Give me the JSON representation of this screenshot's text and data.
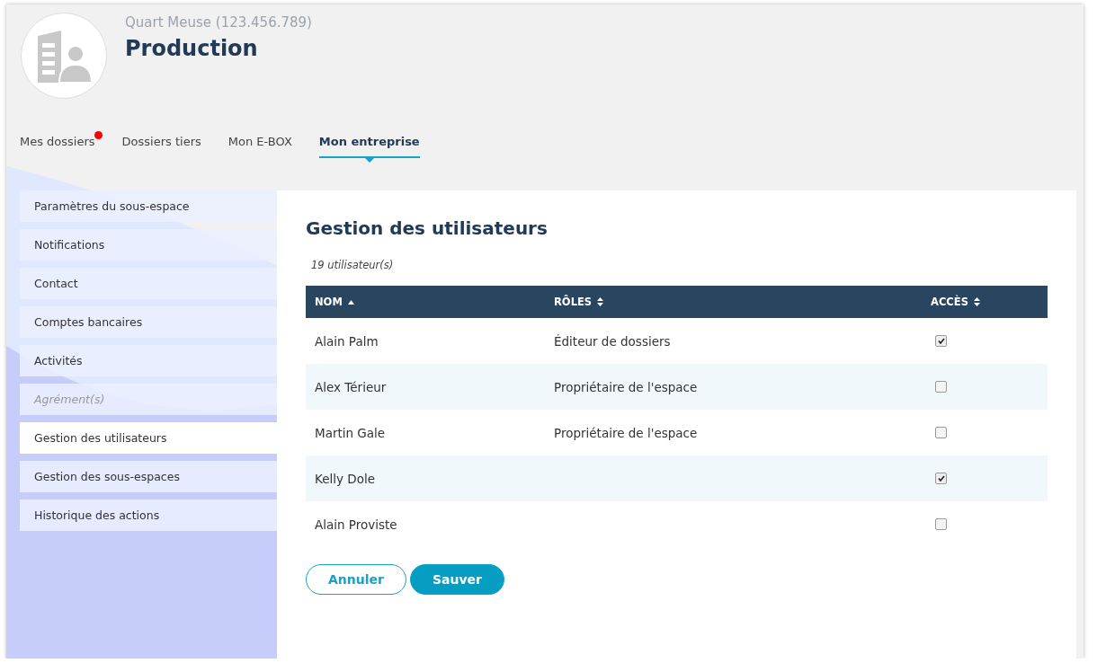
{
  "company": {
    "subtitle": "Quart Meuse (123.456.789)",
    "title": "Production"
  },
  "tabs": [
    {
      "label": "Mes dossiers",
      "selected": false,
      "notification": true
    },
    {
      "label": "Dossiers tiers",
      "selected": false,
      "notification": false
    },
    {
      "label": "Mon E-BOX",
      "selected": false,
      "notification": false
    },
    {
      "label": "Mon entreprise",
      "selected": true,
      "notification": false
    }
  ],
  "sidebar": {
    "items": [
      {
        "label": "Paramètres du sous-espace",
        "selected": false,
        "disabled": false
      },
      {
        "label": "Notifications",
        "selected": false,
        "disabled": false
      },
      {
        "label": "Contact",
        "selected": false,
        "disabled": false
      },
      {
        "label": "Comptes bancaires",
        "selected": false,
        "disabled": false
      },
      {
        "label": "Activités",
        "selected": false,
        "disabled": false
      },
      {
        "label": "Agrément(s)",
        "selected": false,
        "disabled": true
      },
      {
        "label": "Gestion des utilisateurs",
        "selected": true,
        "disabled": false
      },
      {
        "label": "Gestion des sous-espaces",
        "selected": false,
        "disabled": false
      },
      {
        "label": "Historique des actions",
        "selected": false,
        "disabled": false
      }
    ]
  },
  "main": {
    "title": "Gestion des utilisateurs",
    "count": "19 utilisateur(s)"
  },
  "table": {
    "columns": [
      {
        "label": "NOM",
        "sorted": true
      },
      {
        "label": "RÔLES",
        "sorted": false
      },
      {
        "label": "ACCÈS",
        "sorted": false
      }
    ],
    "rows": [
      {
        "name": "Alain Palm",
        "role": "Éditeur de dossiers",
        "access": true
      },
      {
        "name": "Alex Térieur",
        "role": "Propriétaire de l'espace",
        "access": false
      },
      {
        "name": "Martin Gale",
        "role": "Propriétaire de l'espace",
        "access": false
      },
      {
        "name": "Kelly Dole",
        "access": true
      },
      {
        "name": "Alain Proviste",
        "access": false
      }
    ]
  },
  "buttons": [
    {
      "label": "Annuler",
      "kind": "secondary"
    },
    {
      "label": "Sauver",
      "kind": "primary"
    }
  ]
}
